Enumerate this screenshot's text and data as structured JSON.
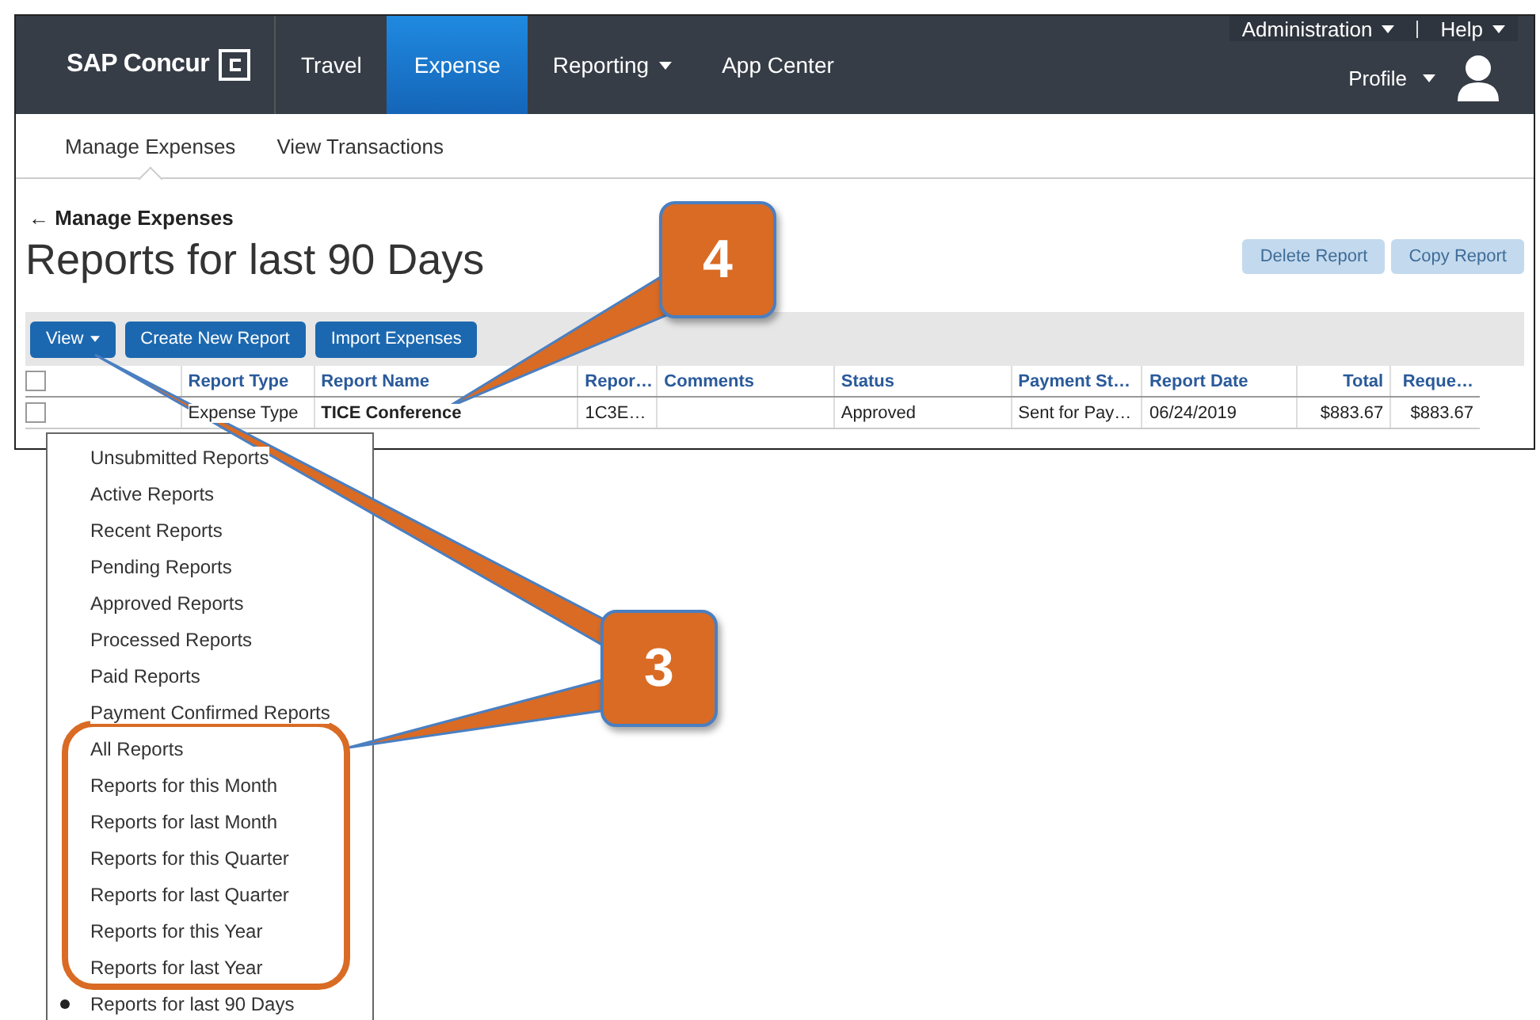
{
  "header": {
    "brand": "SAP Concur",
    "nav": [
      {
        "label": "Travel",
        "selected": false,
        "dropdown": false
      },
      {
        "label": "Expense",
        "selected": true,
        "dropdown": false
      },
      {
        "label": "Reporting",
        "selected": false,
        "dropdown": true
      },
      {
        "label": "App Center",
        "selected": false,
        "dropdown": false
      }
    ],
    "top_links": [
      {
        "label": "Administration"
      },
      {
        "label": "Help"
      }
    ],
    "profile": "Profile"
  },
  "subnav": [
    {
      "label": "Manage Expenses",
      "selected": true
    },
    {
      "label": "View Transactions",
      "selected": false
    }
  ],
  "back_link": "← Manage Expenses",
  "title": "Reports for last 90 Days",
  "actions": [
    {
      "label": "Delete Report",
      "disabled": true
    },
    {
      "label": "Copy Report",
      "disabled": true
    }
  ],
  "toolbar": [
    {
      "label": "View",
      "dropdown": true
    },
    {
      "label": "Create New Report",
      "dropdown": false
    },
    {
      "label": "Import Expenses",
      "dropdown": false
    }
  ],
  "table": {
    "select_all_checked": false,
    "columns": [
      "Report Type",
      "Report Name",
      "Repor…",
      "Comments",
      "Status",
      "Payment St…",
      "Report Date",
      "Total",
      "Reque…"
    ],
    "rows": [
      {
        "checked": false,
        "cells": [
          "Expense Type",
          "TICE Conference",
          "1C3E…",
          "",
          "Approved",
          "Sent for Pay…",
          "06/24/2019",
          "$883.67",
          "$883.67"
        ]
      }
    ]
  },
  "view_menu": [
    {
      "label": "Unsubmitted Reports",
      "selected": false
    },
    {
      "label": "Active Reports",
      "selected": false
    },
    {
      "label": "Recent Reports",
      "selected": false
    },
    {
      "label": "Pending Reports",
      "selected": false
    },
    {
      "label": "Approved Reports",
      "selected": false
    },
    {
      "label": "Processed Reports",
      "selected": false
    },
    {
      "label": "Paid Reports",
      "selected": false
    },
    {
      "label": "Payment Confirmed Reports",
      "selected": false
    },
    {
      "label": "All Reports",
      "selected": false
    },
    {
      "label": "Reports for this Month",
      "selected": false
    },
    {
      "label": "Reports for last Month",
      "selected": false
    },
    {
      "label": "Reports for this Quarter",
      "selected": false
    },
    {
      "label": "Reports for last Quarter",
      "selected": false
    },
    {
      "label": "Reports for this Year",
      "selected": false
    },
    {
      "label": "Reports for last Year",
      "selected": false
    },
    {
      "label": "Reports for last 90 Days",
      "selected": true
    }
  ],
  "annotations": [
    {
      "label": "4"
    },
    {
      "label": "3"
    }
  ]
}
